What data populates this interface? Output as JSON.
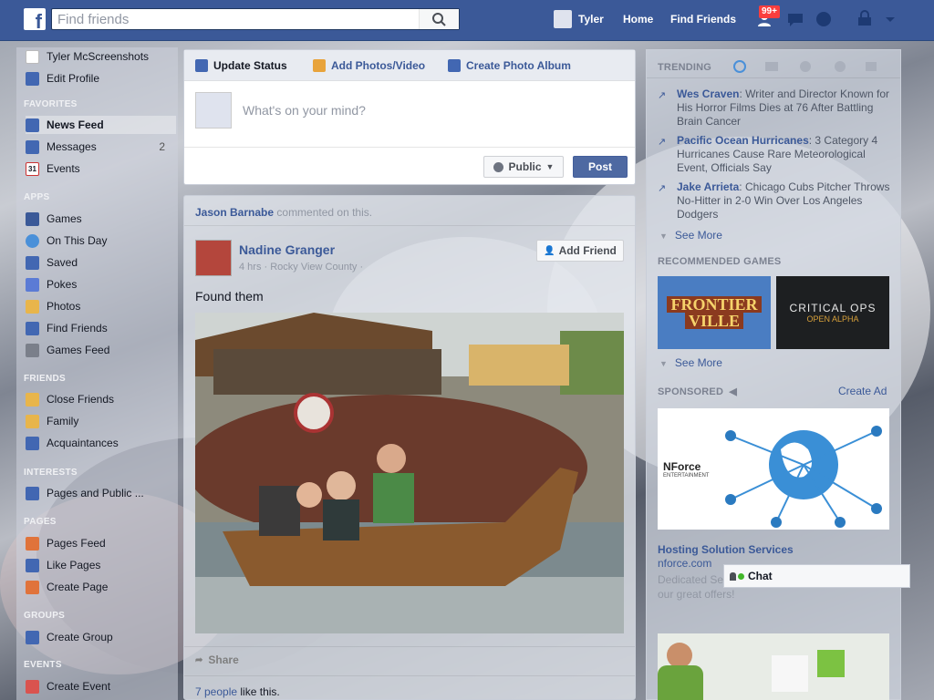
{
  "topbar": {
    "logo": "f",
    "search_placeholder": "Find friends",
    "user": "Tyler",
    "home": "Home",
    "find_friends": "Find Friends",
    "friend_requests_badge": "99+"
  },
  "leftnav": {
    "user_name": "Tyler McScreenshots",
    "edit_profile": "Edit Profile",
    "sections": {
      "favorites": "FAVORITES",
      "apps": "APPS",
      "friends": "FRIENDS",
      "interests": "INTERESTS",
      "pages": "PAGES",
      "groups": "GROUPS",
      "events": "EVENTS"
    },
    "favorites": [
      {
        "label": "News Feed",
        "count": ""
      },
      {
        "label": "Messages",
        "count": "2"
      },
      {
        "label": "Events",
        "count": ""
      }
    ],
    "apps": [
      "Games",
      "On This Day",
      "Saved",
      "Pokes",
      "Photos",
      "Find Friends",
      "Games Feed"
    ],
    "friends": [
      "Close Friends",
      "Family",
      "Acquaintances"
    ],
    "interests": [
      "Pages and Public ..."
    ],
    "pages": [
      "Pages Feed",
      "Like Pages",
      "Create Page"
    ],
    "groups": [
      "Create Group"
    ],
    "events": [
      "Create Event"
    ],
    "events_icon_day": "31"
  },
  "composer": {
    "tab_status": "Update Status",
    "tab_photos": "Add Photos/Video",
    "tab_album": "Create Photo Album",
    "placeholder": "What's on your mind?",
    "audience": "Public",
    "post_button": "Post"
  },
  "post": {
    "commenter": "Jason Barnabe",
    "commented_text": "commented on this.",
    "author": "Nadine Granger",
    "meta": "4 hrs · Rocky View County ·",
    "add_friend": "Add Friend",
    "text": "Found them",
    "share": "Share",
    "likes_count": "7 people",
    "likes_text": "like this."
  },
  "rightcol": {
    "trending_header": "TRENDING",
    "trends": [
      {
        "topic": "Wes Craven",
        "desc": ": Writer and Director Known for His Horror Films Dies at 76 After Battling Brain Cancer"
      },
      {
        "topic": "Pacific Ocean Hurricanes",
        "desc": ": 3 Category 4 Hurricanes Cause Rare Meteorological Event, Officials Say"
      },
      {
        "topic": "Jake Arrieta",
        "desc": ": Chicago Cubs Pitcher Throws No-Hitter in 2-0 Win Over Los Angeles Dodgers"
      }
    ],
    "see_more": "See More",
    "games_header": "RECOMMENDED GAMES",
    "games": [
      {
        "line1": "FRONTIER",
        "line2": "VILLE"
      },
      {
        "line1": "CRITICAL OPS",
        "line2": "OPEN ALPHA"
      }
    ],
    "games_see_more": "See More",
    "sponsored_header": "SPONSORED",
    "create_ad": "Create Ad",
    "ad_brand": "NForce",
    "ad_brand_sub": "ENTERTAINMENT",
    "ad_title": "Hosting Solution Services",
    "ad_domain": "nforce.com",
    "ad_desc": "Dedicated Se... and Webhosting, Discover our great offers!"
  },
  "chat": {
    "label": "Chat"
  },
  "colors": {
    "brand": "#3b5998",
    "link": "#3b5998",
    "post_button": "#4e69a2"
  }
}
